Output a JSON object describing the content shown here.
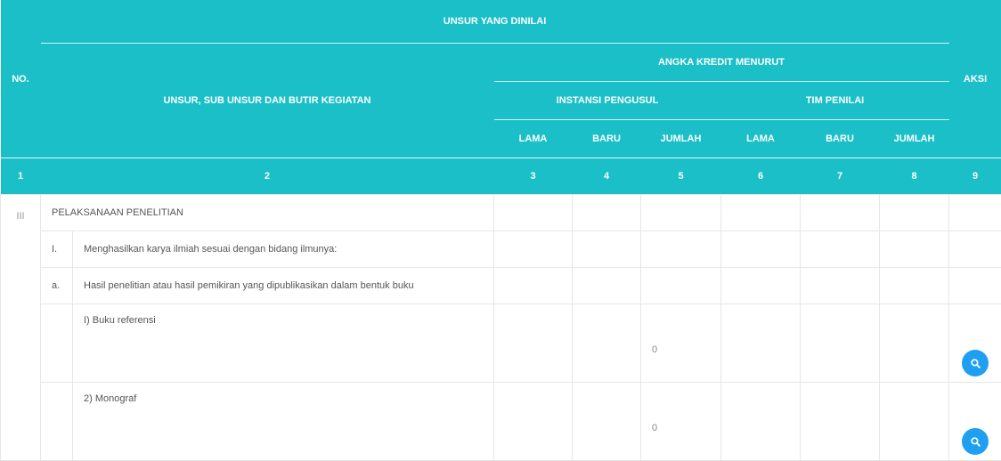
{
  "header": {
    "no": "NO.",
    "unsur_yang_dinilai": "UNSUR YANG DINILAI",
    "unsur_sub": "UNSUR, SUB UNSUR DAN BUTIR KEGIATAN",
    "angka_kredit": "ANGKA KREDIT MENURUT",
    "instansi": "INSTANSI PENGUSUL",
    "tim": "TIM PENILAI",
    "aksi": "AKSI",
    "cols": [
      "LAMA",
      "BARU",
      "JUMLAH",
      "LAMA",
      "BARU",
      "JUMLAH"
    ],
    "numbers": [
      "1",
      "2",
      "3",
      "4",
      "5",
      "6",
      "7",
      "8",
      "9"
    ]
  },
  "rows": [
    {
      "no": "III",
      "text": "PELAKSANAAN PENELITIAN"
    },
    {
      "sub": "I.",
      "text": "Menghasilkan karya ilmiah sesuai dengan bidang ilmunya:"
    },
    {
      "sub": "a.",
      "text": "Hasil penelitian atau hasil pemikiran yang dipublikasikan dalam bentuk buku"
    },
    {
      "text": "I) Buku referensi",
      "jumlah": "0"
    },
    {
      "text": "2) Monograf",
      "jumlah": "0"
    }
  ],
  "icons": {
    "view": "search-icon"
  },
  "colors": {
    "header_bg": "#1abfc8",
    "button_bg": "#1e9ff2"
  }
}
